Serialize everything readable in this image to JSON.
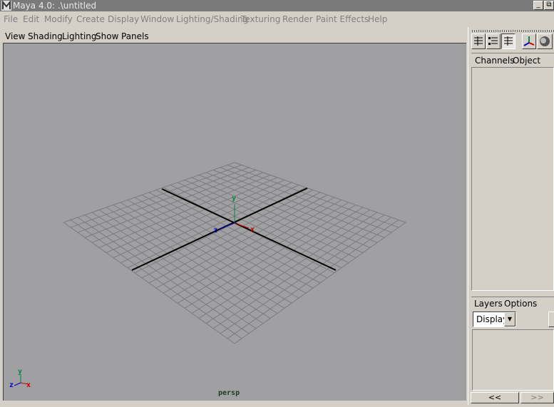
{
  "window": {
    "title": "Maya 4.0: .\\untitled",
    "minimize": "_",
    "restore": "⧉"
  },
  "menubar": [
    "File",
    "Edit",
    "Modify",
    "Create",
    "Display",
    "Window",
    "Lighting/Shading",
    "Texturing",
    "Render",
    "Paint Effects",
    "Help"
  ],
  "panel_menu": [
    "View",
    "Shading",
    "Lighting",
    "Show",
    "Panels"
  ],
  "viewport": {
    "camera_label": "persp",
    "axis_labels": {
      "x": "x",
      "y": "y",
      "z": "z"
    },
    "background": "#a0a0a2",
    "axis_colors": {
      "x": "#cc0000",
      "y": "#008844",
      "z": "#0000cc"
    }
  },
  "channel_box": {
    "tab_channels": "Channels",
    "tab_object": "Object"
  },
  "layers": {
    "tab_layers": "Layers",
    "tab_options": "Options",
    "display_value": "Display"
  },
  "nav": {
    "prev": "<<",
    "next": ">>"
  },
  "toolbar_icons": [
    "channel-box-icon",
    "attribute-editor-icon",
    "channel-layer-icon",
    "manipulator-icon",
    "render-sphere-icon"
  ]
}
